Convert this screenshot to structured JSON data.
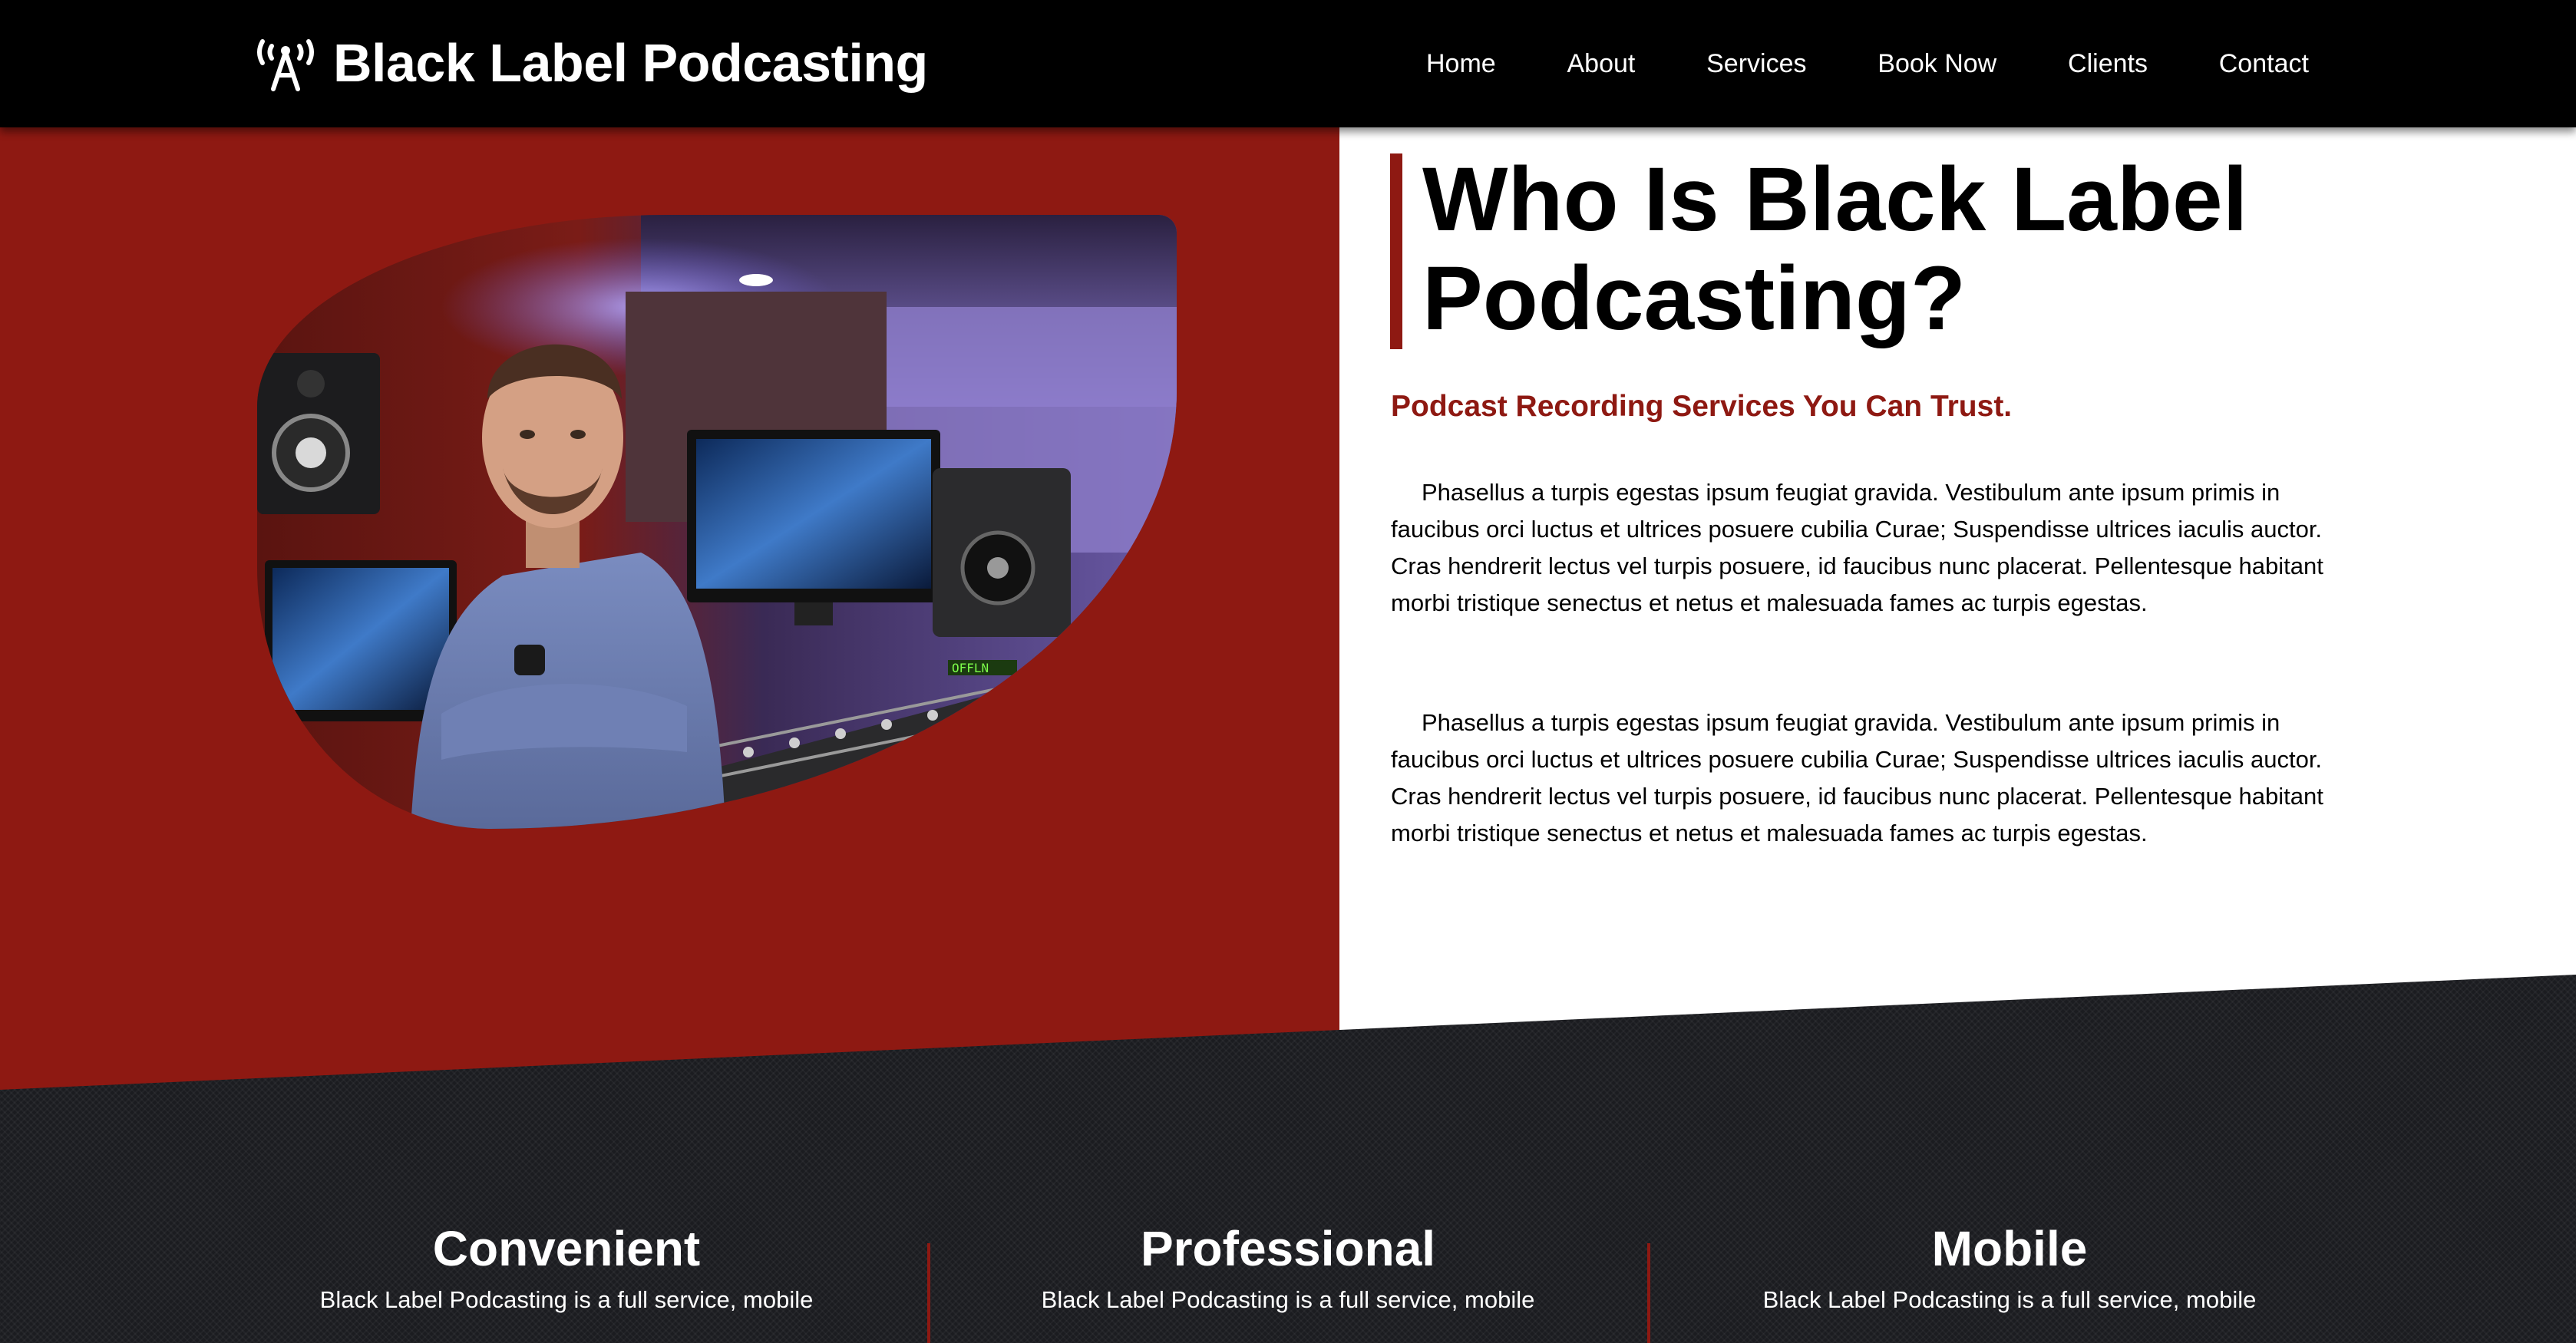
{
  "header": {
    "brand": "Black Label Podcasting",
    "brand_icon": "broadcast-tower-icon",
    "nav": [
      "Home",
      "About",
      "Services",
      "Book Now",
      "Clients",
      "Contact"
    ]
  },
  "hero": {
    "heading": "Who Is Black Label Podcasting?",
    "subheading": "Podcast Recording Services You Can Trust.",
    "paragraphs": [
      "Phasellus a turpis egestas ipsum feugiat gravida. Vestibulum ante ipsum primis in faucibus orci luctus et ultrices posuere cubilia Curae; Suspendisse ultrices iaculis auctor. Cras hendrerit lectus vel turpis posuere, id faucibus nunc placerat. Pellentesque habitant morbi tristique senectus et netus et malesuada fames ac turpis egestas.",
      "Phasellus a turpis egestas ipsum feugiat gravida. Vestibulum ante ipsum primis in faucibus orci luctus et ultrices posuere cubilia Curae; Suspendisse ultrices iaculis auctor. Cras hendrerit lectus vel turpis posuere, id faucibus nunc placerat. Pellentesque habitant morbi tristique senectus et netus et malesuada fames ac turpis egestas."
    ],
    "image_description": "man-in-recording-studio-photo"
  },
  "features": [
    {
      "title": "Convenient",
      "text": "Black Label Podcasting is a full service, mobile"
    },
    {
      "title": "Professional",
      "text": "Black Label Podcasting is a full service, mobile"
    },
    {
      "title": "Mobile",
      "text": "Black Label Podcasting is a full service, mobile"
    }
  ],
  "colors": {
    "accent_red": "#8e1912",
    "navbar": "#000000",
    "dark_section": "#1b1c20"
  }
}
